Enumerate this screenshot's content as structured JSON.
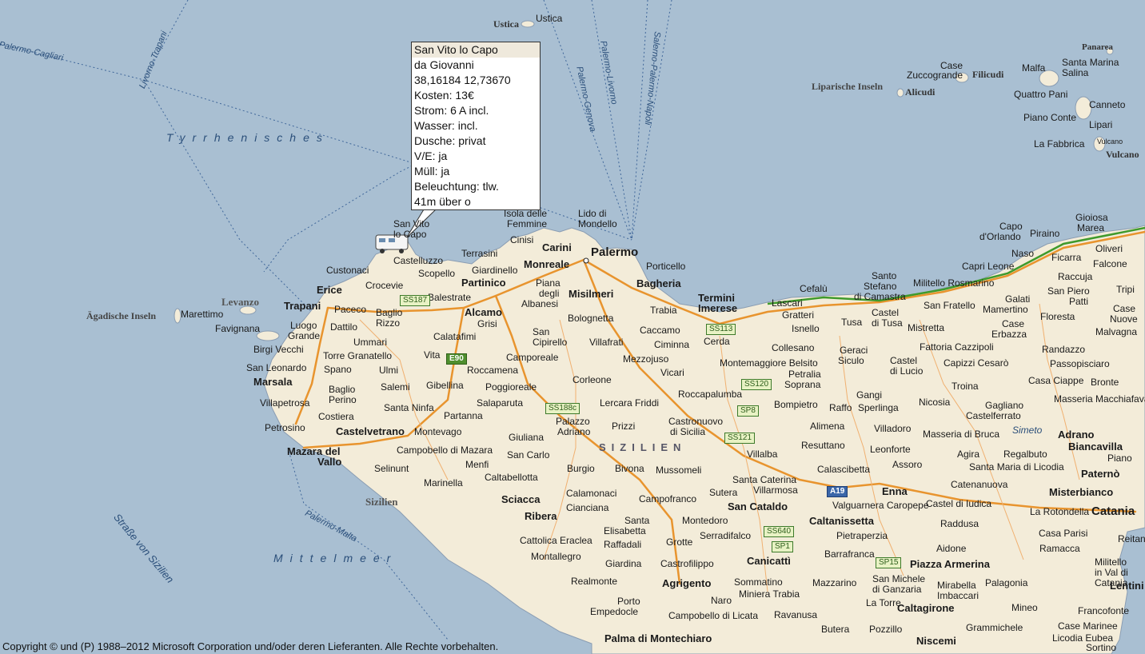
{
  "popup": {
    "title": "San Vito lo Capo",
    "rows": [
      "da Giovanni",
      "38,16184 12,73670",
      "Kosten: 13€",
      "Strom: 6 A incl.",
      "Wasser: incl.",
      "Dusche: privat",
      "V/E: ja",
      "Müll: ja",
      "Beleuchtung: tlw.",
      "41m über o"
    ]
  },
  "copyright": "Copyright © und (P) 1988–2012 Microsoft Corporation und/oder deren Lieferanten. Alle Rechte vorbehalten.",
  "colors": {
    "sea": "#a9bfd2",
    "land": "#f3ecd9",
    "road": "#e8942e",
    "border_green": "#3f9a2c"
  },
  "icons": [
    "camper-icon"
  ],
  "labels": {
    "ustica1": "Ustica",
    "ustica2": "Ustica",
    "palermo_cagliari": "Palermo-Cagliari",
    "livorno_trapani": "Livorno-Trapani",
    "palermo_livorno": "Palermo-Livorno",
    "palermo_genova": "Palermo-Genova",
    "salerno_palermo_napoli": "Salerno-Palermo-Napoli",
    "tyrrhenisches": "Tyrrhenisches",
    "mittelmeer": "Mittelmeer",
    "palermo_malta": "Palermo-Malta",
    "strasse_sizilien": "Straße von Sizilien",
    "liparische": "Liparische Inseln",
    "alicudi": "Alicudi",
    "filicudi": "Filicudi",
    "case_zucco1": "Case",
    "case_zucco2": "Zuccogrande",
    "panarea": "Panarea",
    "malfa": "Malfa",
    "santa_marina1": "Santa Marina",
    "santa_marina2": "Salina",
    "quattro_pani": "Quattro Pani",
    "canneto": "Canneto",
    "piano_conte": "Piano Conte",
    "lipari": "Lipari",
    "la_fabbrica": "La Fabbrica",
    "vulcano_small": "Vulcano",
    "vulcano": "Vulcano",
    "agadische": "Ägadische Inseln",
    "levanzo": "Levanzo",
    "marettimo": "Marettimo",
    "favignana": "Favignana",
    "san_vito1": "San Vito",
    "san_vito2": "lo Capo",
    "isola1": "Isola delle",
    "isola2": "Femmine",
    "lido1": "Lido di",
    "lido2": "Mondello",
    "cinisi": "Cinisi",
    "carini": "Carini",
    "terrasini": "Terrasini",
    "palermo": "Palermo",
    "porticello": "Porticello",
    "giardinello": "Giardinello",
    "monreale": "Monreale",
    "bagheria": "Bagheria",
    "partinico": "Partinico",
    "piana1": "Piana",
    "piana2": "degli",
    "piana3": "Albanesi",
    "misilmeri": "Misilmeri",
    "custonaci": "Custonaci",
    "castelluzzo": "Castelluzzo",
    "scopello": "Scopello",
    "balestrate": "Balestrate",
    "erice": "Erice",
    "crocevie": "Crocevie",
    "trapani": "Trapani",
    "paceco": "Paceco",
    "baglio_rizzo1": "Baglio",
    "baglio_rizzo2": "Rizzo",
    "alcamo": "Alcamo",
    "grisi": "Grisi",
    "bolognetta": "Bolognetta",
    "trabia": "Trabia",
    "termini1": "Termini",
    "termini2": "Imerese",
    "luogo1": "Luogo",
    "luogo2": "Grande",
    "dattilo": "Dattilo",
    "ummari": "Ummari",
    "calatafimi": "Calatafimi",
    "san_cipirello1": "San",
    "san_cipirello2": "Cipirello",
    "villafrati": "Villafrati",
    "caccamo": "Caccamo",
    "ciminna": "Ciminna",
    "cerda": "Cerda",
    "birgi": "Birgi Vecchi",
    "torre_granatello": "Torre Granatello",
    "vita": "Vita",
    "camporeale": "Camporeale",
    "mezzojuso": "Mezzojuso",
    "san_leonardo": "San Leonardo",
    "spano": "Spano",
    "ulmi": "Ulmi",
    "roccamena": "Roccamena",
    "vicari": "Vicari",
    "corleone": "Corleone",
    "marsala": "Marsala",
    "salemi": "Salemi",
    "gibellina": "Gibellina",
    "poggioreale": "Poggioreale",
    "baglio_perino1": "Baglio",
    "baglio_perino2": "Perino",
    "villapetrosa": "Villapetrosa",
    "santa_ninfa": "Santa Ninfa",
    "salaparuta": "Salaparuta",
    "lercara": "Lercara Friddi",
    "roccapalumba": "Roccapalumba",
    "costiera": "Costiera",
    "partanna": "Partanna",
    "palazzo1": "Palazzo",
    "palazzo2": "Adriano",
    "prizzi": "Prizzi",
    "castronuovo1": "Castronuovo",
    "castronuovo2": "di Sicilia",
    "petrosino": "Petrosino",
    "castelvetrano": "Castelvetrano",
    "montevago": "Montevago",
    "giuliana": "Giuliana",
    "sizilien_region": "SIZILIEN",
    "mazara1": "Mazara del",
    "mazara2": "Vallo",
    "campobello_mazara": "Campobello di Mazara",
    "san_carlo": "San Carlo",
    "villalba": "Villalba",
    "menfi": "Menfi",
    "selinunt": "Selinunt",
    "burgio": "Burgio",
    "bivona": "Bivona",
    "mussomeli": "Mussomeli",
    "caltabellotta": "Caltabellotta",
    "marinella": "Marinella",
    "calamonaci": "Calamonaci",
    "sizilien_island": "Sizilien",
    "sciacca": "Sciacca",
    "cianciana": "Cianciana",
    "campofranco": "Campofranco",
    "sutera": "Sutera",
    "santa_caterina1": "Santa Caterina",
    "santa_caterina2": "Villarmosa",
    "san_cataldo": "San Cataldo",
    "ribera": "Ribera",
    "santa_elisabetta1": "Santa",
    "santa_elisabetta2": "Elisabetta",
    "montedoro": "Montedoro",
    "serradifalco": "Serradifalco",
    "raffadali": "Raffadali",
    "grotte": "Grotte",
    "cattolica": "Cattolica Eraclea",
    "montallegro": "Montallegro",
    "giardina": "Giardina",
    "castrofilippo": "Castrofilippo",
    "canicatti": "Canicattì",
    "realmonte": "Realmonte",
    "agrigento": "Agrigento",
    "sommatino": "Sommatino",
    "naro": "Naro",
    "miniera": "Miniera Trabia",
    "porto": "Porto",
    "empedocle": "Empedocle",
    "campobello_licata": "Campobello di Licata",
    "ravanusa": "Ravanusa",
    "palma": "Palma di Montechiaro",
    "capo1": "Capo",
    "capo2": "d'Orlando",
    "piraino": "Piraino",
    "gioiosa1": "Gioiosa",
    "gioiosa2": "Marea",
    "oliveri": "Oliveri",
    "naso": "Naso",
    "ficarra": "Ficarra",
    "falcone": "Falcone",
    "santo1": "Santo",
    "santo2": "Stefano",
    "santo3": "di Camastra",
    "capri_leone": "Capri Leone",
    "cefalu": "Cefalù",
    "militello": "Militello Rosmarino",
    "raccuja": "Raccuja",
    "tripi": "Tripi",
    "san_piero1": "San Piero",
    "san_piero2": "Patti",
    "galati1": "Galati",
    "galati2": "Mamertino",
    "case1": "Case",
    "case2": "Nuove",
    "lascari": "Lascari",
    "tusa": "Tusa",
    "castel_tusa1": "Castel",
    "castel_tusa2": "di Tusa",
    "san_fratello": "San Fratello",
    "floresta": "Floresta",
    "malvagna": "Malvagna",
    "gratteri": "Gratteri",
    "isnello": "Isnello",
    "mistretta": "Mistretta",
    "case_erbazza1": "Case",
    "case_erbazza2": "Erbazza",
    "collesano": "Collesano",
    "geraci1": "Geraci",
    "geraci2": "Siculo",
    "fattoria": "Fattoria Cazzipoli",
    "randazzo": "Randazzo",
    "montemaggiore": "Montemaggiore Belsito",
    "castel_lucio1": "Castel",
    "castel_lucio2": "di Lucio",
    "capizzi": "Capizzi Cesarò",
    "passopisciaro": "Passopisciaro",
    "petralia1": "Petralia",
    "petralia2": "Soprana",
    "troina": "Troina",
    "case_ciappe": "Casa Ciappe",
    "bronte": "Bronte",
    "gangi": "Gangi",
    "masseria_macchiafava": "Masseria Macchiafava",
    "bompietro": "Bompietro",
    "raffo": "Raffo",
    "sperlinga": "Sperlinga",
    "nicosia": "Nicosia",
    "gagliano1": "Gagliano",
    "gagliano2": "Castelferrato",
    "alimena": "Alimena",
    "villadoro": "Villadoro",
    "masseria_bruca": "Masseria di Bruca",
    "simeto": "Simeto",
    "adrano": "Adrano",
    "biancavilla": "Biancavilla",
    "piano": "Piano",
    "resuttano": "Resuttano",
    "leonforte": "Leonforte",
    "agira": "Agira",
    "regalbuto": "Regalbuto",
    "santa_maria_licodia": "Santa Maria di Licodia",
    "paterno": "Paternò",
    "calascibetta": "Calascibetta",
    "assoro": "Assoro",
    "catenanuova": "Catenanuova",
    "enna": "Enna",
    "misterbianco": "Misterbianco",
    "valguarnera": "Valguarnera Caropepe",
    "castel_iudica": "Castel di Iudica",
    "la_rotondella": "La Rotondella",
    "catania": "Catania",
    "caltanissetta": "Caltanissetta",
    "raddusa": "Raddusa",
    "pietraperzia": "Pietraperzia",
    "casa_parisi": "Casa Parisi",
    "reitano": "Reitano",
    "barrafranca": "Barrafranca",
    "aidone": "Aidone",
    "ramacca": "Ramacca",
    "piazza": "Piazza Armerina",
    "militello_val1": "Militello",
    "militello_val2": "in Val di",
    "militello_val3": "Catania",
    "lentini": "Lentini",
    "mazzarino": "Mazzarino",
    "san_michele1": "San Michele",
    "san_michele2": "di Ganzaria",
    "mirabella1": "Mirabella",
    "mirabella2": "Imbaccari",
    "palagonia": "Palagonia",
    "la_torre": "La Torre",
    "caltagirone": "Caltagirone",
    "mineo": "Mineo",
    "francofonte": "Francofonte",
    "butera": "Butera",
    "pozzillo": "Pozzillo",
    "grammichele": "Grammichele",
    "case_marinee": "Case Marinee",
    "niscemi": "Niscemi",
    "licodia": "Licodia Eubea",
    "sortino": "Sortino"
  },
  "roads": {
    "ss187": "SS187",
    "e90": "E90",
    "ss113": "SS113",
    "ss188c": "SS188c",
    "ss120": "SS120",
    "ss8": "SP8",
    "ss121": "SS121",
    "a19": "A19",
    "ss640": "SS640",
    "sp1": "SP1",
    "sp15": "SP15"
  }
}
